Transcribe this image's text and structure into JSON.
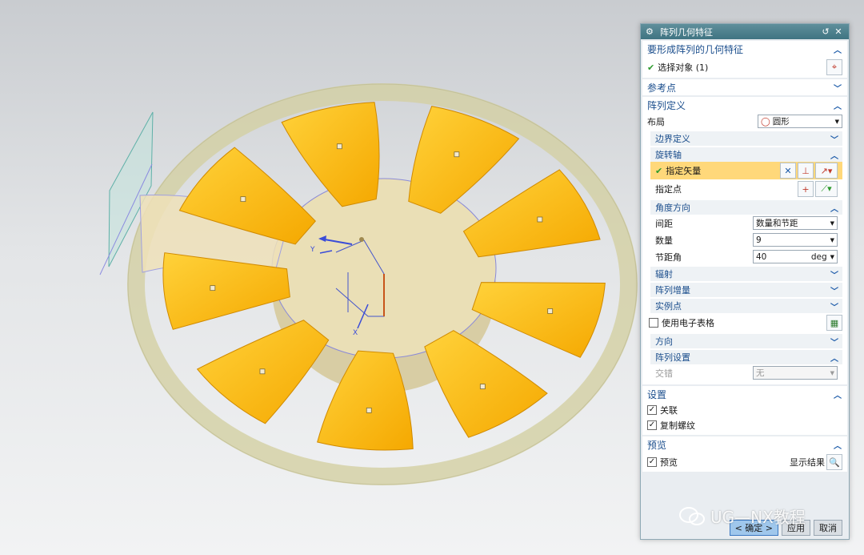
{
  "dialog": {
    "title": "阵列几何特征",
    "title_icon": "gear-icon",
    "reset_icon": "reset-icon",
    "close_icon": "close-icon",
    "sections": {
      "geometry": {
        "title": "要形成阵列的几何特征",
        "select_label": "选择对象 (1)"
      },
      "reference": {
        "title": "参考点"
      },
      "definition": {
        "title": "阵列定义",
        "layout_label": "布局",
        "layout_value": "圆形",
        "boundary": "边界定义",
        "rotation_axis": "旋转轴",
        "specify_vector": "指定矢量",
        "specify_point": "指定点",
        "angle_direction": "角度方向",
        "spacing_label": "间距",
        "spacing_value": "数量和节距",
        "count_label": "数量",
        "count_value": "9",
        "pitch_label": "节距角",
        "pitch_value": "40",
        "pitch_unit": "deg",
        "radiation": "辐射",
        "increment": "阵列增量",
        "instance_points": "实例点",
        "use_spreadsheet": "使用电子表格",
        "direction": "方向",
        "pattern_settings": "阵列设置",
        "stagger_label": "交错",
        "stagger_value": "无"
      },
      "settings": {
        "title": "设置",
        "associative": "关联",
        "copy_threads": "复制螺纹"
      },
      "preview": {
        "title": "预览",
        "preview_label": "预览",
        "show_result": "显示结果"
      }
    },
    "buttons": {
      "ok": "< 确定 >",
      "apply": "应用",
      "cancel": "取消"
    }
  },
  "viewport": {
    "blade_count": 9,
    "axis_x": "X",
    "axis_y": "Y"
  },
  "watermark": "UG—NX教程",
  "colors": {
    "blade": "#ffc21a",
    "hub": "#e9dcb0",
    "ring": "#d6d2a8",
    "highlight": "#ffd87a",
    "titlebar": "#4f8290"
  }
}
